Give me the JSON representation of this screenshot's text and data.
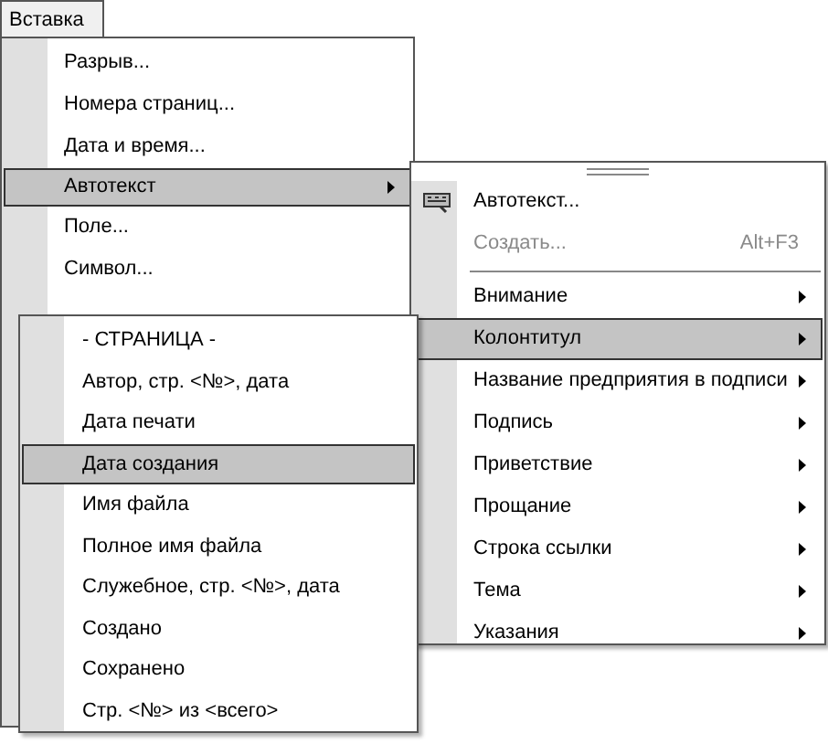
{
  "menu_bar": {
    "title": "Вставка"
  },
  "insert_menu": {
    "items": [
      {
        "label": "Разрыв...",
        "selected": false,
        "submenu": false
      },
      {
        "label": "Номера страниц...",
        "selected": false,
        "submenu": false
      },
      {
        "label": "Дата и время...",
        "selected": false,
        "submenu": false
      },
      {
        "label": "Автотекст",
        "selected": true,
        "submenu": true
      },
      {
        "label": "Поле...",
        "selected": false,
        "submenu": false
      },
      {
        "label": "Символ...",
        "selected": false,
        "submenu": false
      }
    ]
  },
  "autotext_menu": {
    "items": [
      {
        "kind": "item",
        "label": "Автотекст...",
        "icon": true,
        "disabled": false,
        "selected": false,
        "submenu": false
      },
      {
        "kind": "item",
        "label": "Создать...",
        "shortcut": "Alt+F3",
        "disabled": true,
        "selected": false,
        "submenu": false
      },
      {
        "kind": "separator"
      },
      {
        "kind": "item",
        "label": "Внимание",
        "disabled": false,
        "selected": false,
        "submenu": true
      },
      {
        "kind": "item",
        "label": "Колонтитул",
        "disabled": false,
        "selected": true,
        "submenu": true
      },
      {
        "kind": "item",
        "label": "Название предприятия в подписи",
        "disabled": false,
        "selected": false,
        "submenu": true
      },
      {
        "kind": "item",
        "label": "Подпись",
        "disabled": false,
        "selected": false,
        "submenu": true
      },
      {
        "kind": "item",
        "label": "Приветствие",
        "disabled": false,
        "selected": false,
        "submenu": true
      },
      {
        "kind": "item",
        "label": "Прощание",
        "disabled": false,
        "selected": false,
        "submenu": true
      },
      {
        "kind": "item",
        "label": "Строка ссылки",
        "disabled": false,
        "selected": false,
        "submenu": true
      },
      {
        "kind": "item",
        "label": "Тема",
        "disabled": false,
        "selected": false,
        "submenu": true
      },
      {
        "kind": "item",
        "label": "Указания",
        "disabled": false,
        "selected": false,
        "submenu": true
      }
    ]
  },
  "header_footer_menu": {
    "items": [
      {
        "label": "- СТРАНИЦА -",
        "selected": false
      },
      {
        "label": "Автор, стр. <№>, дата",
        "selected": false
      },
      {
        "label": "Дата печати",
        "selected": false
      },
      {
        "label": "Дата создания",
        "selected": true
      },
      {
        "label": "Имя файла",
        "selected": false
      },
      {
        "label": "Полное имя файла",
        "selected": false
      },
      {
        "label": "Служебное, стр. <№>, дата",
        "selected": false
      },
      {
        "label": "Создано",
        "selected": false
      },
      {
        "label": "Сохранено",
        "selected": false
      },
      {
        "label": "Стр. <№> из <всего>",
        "selected": false
      }
    ]
  }
}
